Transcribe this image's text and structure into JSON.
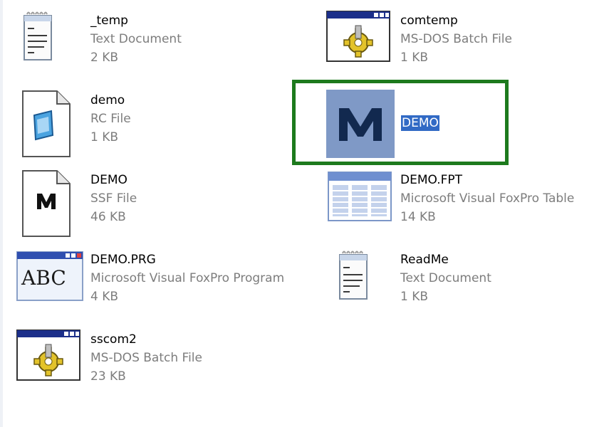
{
  "window": {
    "title": ""
  },
  "files": [
    {
      "id": "temp",
      "name": "_temp",
      "type": "Text Document",
      "size": "2 KB",
      "icon": "notepad-icon"
    },
    {
      "id": "comtemp",
      "name": "comtemp",
      "type": "MS-DOS Batch File",
      "size": "1 KB",
      "icon": "batch-file-icon"
    },
    {
      "id": "demo_rc",
      "name": "demo",
      "type": "RC File",
      "size": "1 KB",
      "icon": "resource-file-icon"
    },
    {
      "id": "selected",
      "name": "DEMO",
      "type": "",
      "size": "",
      "icon": "m-app-icon"
    },
    {
      "id": "demo_ssf",
      "name": "DEMO",
      "type": "SSF File",
      "size": "46 KB",
      "icon": "m-document-icon"
    },
    {
      "id": "demo_fpt",
      "name": "DEMO.FPT",
      "type": "Microsoft Visual FoxPro Table",
      "size": "14 KB",
      "icon": "table-icon"
    },
    {
      "id": "demo_prg",
      "name": "DEMO.PRG",
      "type": "Microsoft Visual FoxPro Program",
      "size": "4 KB",
      "icon": "abc-program-icon"
    },
    {
      "id": "readme",
      "name": "ReadMe",
      "type": "Text Document",
      "size": "1 KB",
      "icon": "notepad-icon"
    },
    {
      "id": "sscom2",
      "name": "sscom2",
      "type": "MS-DOS Batch File",
      "size": "23 KB",
      "icon": "batch-file-icon"
    }
  ],
  "selection": {
    "highlight_color": "#316ac5",
    "frame_color": "#1d7a1d"
  }
}
